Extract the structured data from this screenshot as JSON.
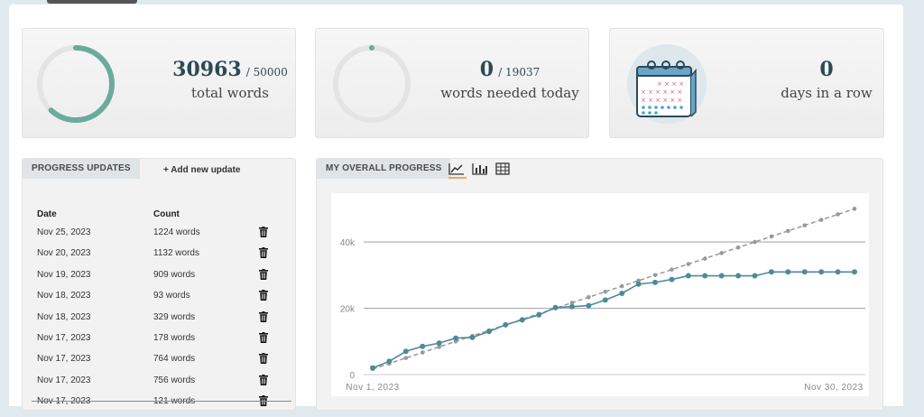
{
  "stats": {
    "total": {
      "value": "30963",
      "goal": "/ 50000",
      "label": "total words",
      "progress": 0.619
    },
    "today": {
      "value": "0",
      "goal": "/ 19037",
      "label": "words needed today",
      "progress": 0.0
    },
    "streak": {
      "value": "0",
      "label": "days in a row",
      "icon": "calendar-icon"
    }
  },
  "updates": {
    "title": "PROGRESS UPDATES",
    "add_label": "+ Add new update",
    "headers": {
      "date": "Date",
      "count": "Count"
    },
    "rows": [
      {
        "date": "Nov 25, 2023",
        "count": "1224 words"
      },
      {
        "date": "Nov 20, 2023",
        "count": "1132 words"
      },
      {
        "date": "Nov 19, 2023",
        "count": "909 words"
      },
      {
        "date": "Nov 18, 2023",
        "count": "93 words"
      },
      {
        "date": "Nov 18, 2023",
        "count": "329 words"
      },
      {
        "date": "Nov 17, 2023",
        "count": "178 words"
      },
      {
        "date": "Nov 17, 2023",
        "count": "764 words"
      },
      {
        "date": "Nov 17, 2023",
        "count": "756 words"
      },
      {
        "date": "Nov 17, 2023",
        "count": "121 words"
      }
    ]
  },
  "overall": {
    "title": "MY OVERALL PROGRESS",
    "tools": [
      "line-chart-icon",
      "bar-chart-icon",
      "table-icon"
    ]
  },
  "colors": {
    "accent": "#6aab9c",
    "actual": "#4e8b9a",
    "target": "#999999",
    "highlight": "#e9a46b"
  },
  "chart_data": {
    "type": "line",
    "x": [
      "Nov 1, 2023",
      "Nov 2, 2023",
      "Nov 3, 2023",
      "Nov 4, 2023",
      "Nov 5, 2023",
      "Nov 6, 2023",
      "Nov 7, 2023",
      "Nov 8, 2023",
      "Nov 9, 2023",
      "Nov 10, 2023",
      "Nov 11, 2023",
      "Nov 12, 2023",
      "Nov 13, 2023",
      "Nov 14, 2023",
      "Nov 15, 2023",
      "Nov 16, 2023",
      "Nov 17, 2023",
      "Nov 18, 2023",
      "Nov 19, 2023",
      "Nov 20, 2023",
      "Nov 21, 2023",
      "Nov 22, 2023",
      "Nov 23, 2023",
      "Nov 24, 2023",
      "Nov 25, 2023",
      "Nov 26, 2023",
      "Nov 27, 2023",
      "Nov 28, 2023",
      "Nov 29, 2023",
      "Nov 30, 2023"
    ],
    "x_tick_labels": [
      "Nov 1, 2023",
      "Nov 30, 2023"
    ],
    "series": [
      {
        "values": [
          2000,
          4000,
          7000,
          8500,
          9500,
          11000,
          11200,
          13000,
          15000,
          16500,
          18000,
          20200,
          20500,
          20800,
          22500,
          24500,
          27300,
          27800,
          28700,
          29800,
          29800,
          29800,
          29800,
          29800,
          30963,
          30963,
          30963,
          30963,
          30963,
          30963
        ]
      },
      {
        "values": [
          1667,
          3333,
          5000,
          6667,
          8333,
          10000,
          11667,
          13333,
          15000,
          16667,
          18333,
          20000,
          21667,
          23333,
          25000,
          26667,
          28333,
          30000,
          31667,
          33333,
          35000,
          36667,
          38333,
          40000,
          41667,
          43333,
          45000,
          46667,
          48333,
          50000
        ]
      }
    ],
    "y_ticks": [
      "0",
      "20k",
      "40k"
    ],
    "ylim": [
      0,
      52000
    ],
    "grid": true
  }
}
